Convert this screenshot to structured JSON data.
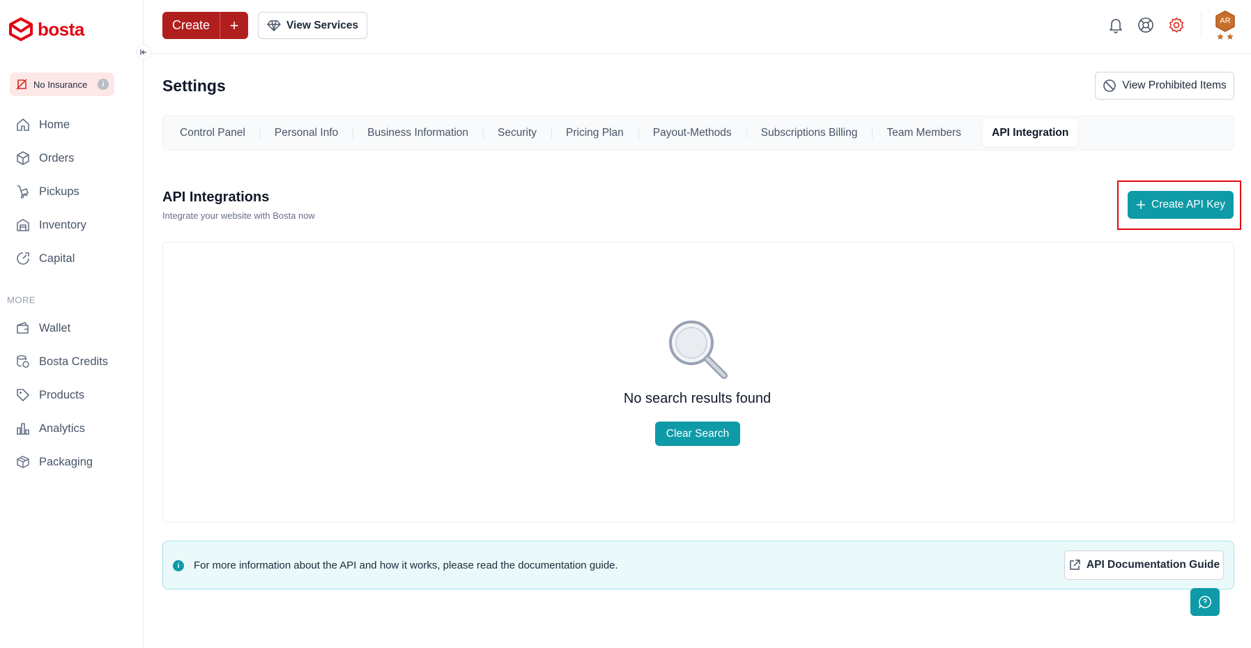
{
  "brand": {
    "name": "bosta",
    "color": "#e30613"
  },
  "accent_color": "#0e9aa7",
  "sidebar": {
    "insurance_badge": "No Insurance",
    "items": [
      {
        "label": "Home",
        "icon": "home-icon"
      },
      {
        "label": "Orders",
        "icon": "box-icon"
      },
      {
        "label": "Pickups",
        "icon": "trolley-icon"
      },
      {
        "label": "Inventory",
        "icon": "warehouse-icon"
      },
      {
        "label": "Capital",
        "icon": "gauge-icon"
      }
    ],
    "more_label": "MORE",
    "more_items": [
      {
        "label": "Wallet",
        "icon": "wallet-icon"
      },
      {
        "label": "Bosta Credits",
        "icon": "coins-icon"
      },
      {
        "label": "Products",
        "icon": "tag-icon"
      },
      {
        "label": "Analytics",
        "icon": "bar-chart-icon"
      },
      {
        "label": "Packaging",
        "icon": "package-icon"
      }
    ]
  },
  "header": {
    "create_label": "Create",
    "create_plus": "+",
    "view_services_label": "View Services",
    "avatar_initials": "AR"
  },
  "page": {
    "title": "Settings",
    "prohibited_label": "View Prohibited Items",
    "tabs": [
      {
        "label": "Control Panel"
      },
      {
        "label": "Personal Info"
      },
      {
        "label": "Business Information"
      },
      {
        "label": "Security"
      },
      {
        "label": "Pricing Plan"
      },
      {
        "label": "Payout-Methods"
      },
      {
        "label": "Subscriptions Billing"
      },
      {
        "label": "Team Members"
      },
      {
        "label": "API Integration",
        "active": true
      }
    ]
  },
  "api": {
    "title": "API Integrations",
    "subtitle": "Integrate your website with Bosta now",
    "create_key_label": "Create API Key",
    "empty_text": "No search results found",
    "clear_label": "Clear Search",
    "banner_text": "For more information about the API and how it works, please read the documentation guide.",
    "doc_label": "API Documentation Guide"
  }
}
